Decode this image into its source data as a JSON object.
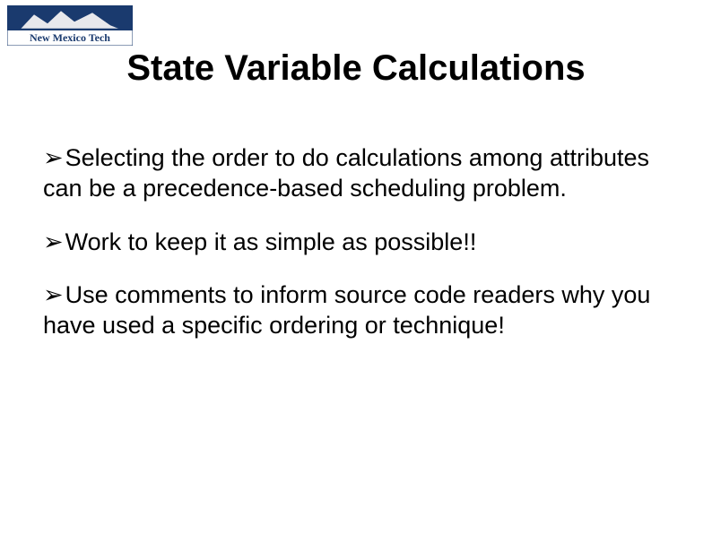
{
  "logo": {
    "text_top": "New Mexico Tech",
    "alt": "New Mexico Tech logo"
  },
  "title": "State Variable Calculations",
  "bullets": [
    "Selecting the order to do calculations among attributes can be a precedence-based scheduling problem.",
    "Work to keep it as simple as possible!!",
    "Use comments to inform source code readers why you have used a specific ordering or technique!"
  ]
}
